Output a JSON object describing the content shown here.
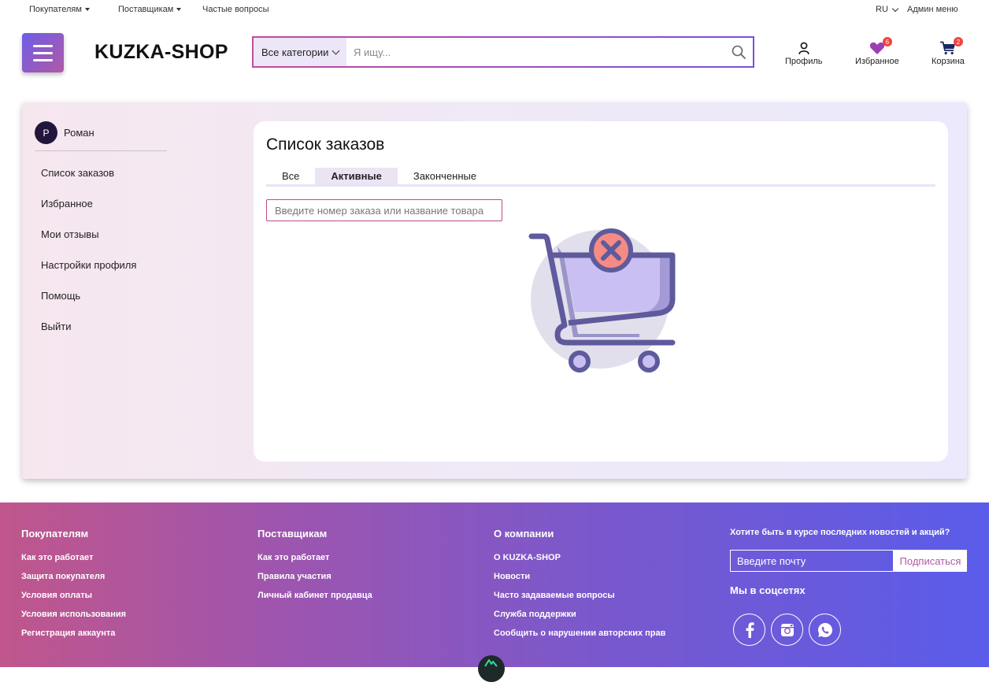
{
  "topbar": {
    "buyers": "Покупателям",
    "suppliers": "Поставщикам",
    "faq": "Частые вопросы",
    "lang": "RU",
    "admin": "Админ меню"
  },
  "header": {
    "logo": "KUZKA-SHOP",
    "search": {
      "category": "Все категории",
      "placeholder": "Я ищу..."
    },
    "profile_label": "Профиль",
    "favorites_label": "Избранное",
    "favorites_count": "6",
    "cart_label": "Корзина",
    "cart_count": "2"
  },
  "account": {
    "user_initial": "Р",
    "user_name": "Роман",
    "menu": [
      "Список заказов",
      "Избранное",
      "Мои отзывы",
      "Настройки профиля",
      "Помощь",
      "Выйти"
    ],
    "title": "Список заказов",
    "tabs": [
      "Все",
      "Активные",
      "Законченные"
    ],
    "active_tab": "Активные",
    "order_search_placeholder": "Введите номер заказа или название товара"
  },
  "footer": {
    "buyers": {
      "title": "Покупателям",
      "links": [
        "Как это работает",
        "Защита покупателя",
        "Условия оплаты",
        "Условия использования",
        "Регистрация аккаунта"
      ]
    },
    "suppliers": {
      "title": "Поставщикам",
      "links": [
        "Как это работает",
        "Правила участия",
        "Личный кабинет продавца"
      ]
    },
    "company": {
      "title": "О компании",
      "links": [
        "О KUZKA-SHOP",
        "Новости",
        "Часто задаваемые вопросы",
        "Служба поддержки",
        "Сообщить о нарушении авторских прав"
      ]
    },
    "newsletter_title": "Хотите быть в курсе последних новостей и акций?",
    "email_placeholder": "Введите почту",
    "subscribe_label": "Подписаться",
    "social_title": "Мы в соцсетях"
  },
  "colors": {
    "accent": "#a64ac9",
    "badge": "#f0443e",
    "heart": "#9b3fb5",
    "cart_fill": "#c9bff2",
    "cart_stroke": "#5f5a9c",
    "cancel_circle": "#f58b84"
  },
  "icons": {
    "burger": "hamburger-menu-icon",
    "search": "search-icon",
    "profile": "user-icon",
    "favorites": "heart-icon",
    "cart": "shopping-cart-icon",
    "empty": "empty-cart-cancel-icon",
    "facebook": "facebook-icon",
    "instagram": "instagram-icon",
    "whatsapp": "whatsapp-icon"
  }
}
